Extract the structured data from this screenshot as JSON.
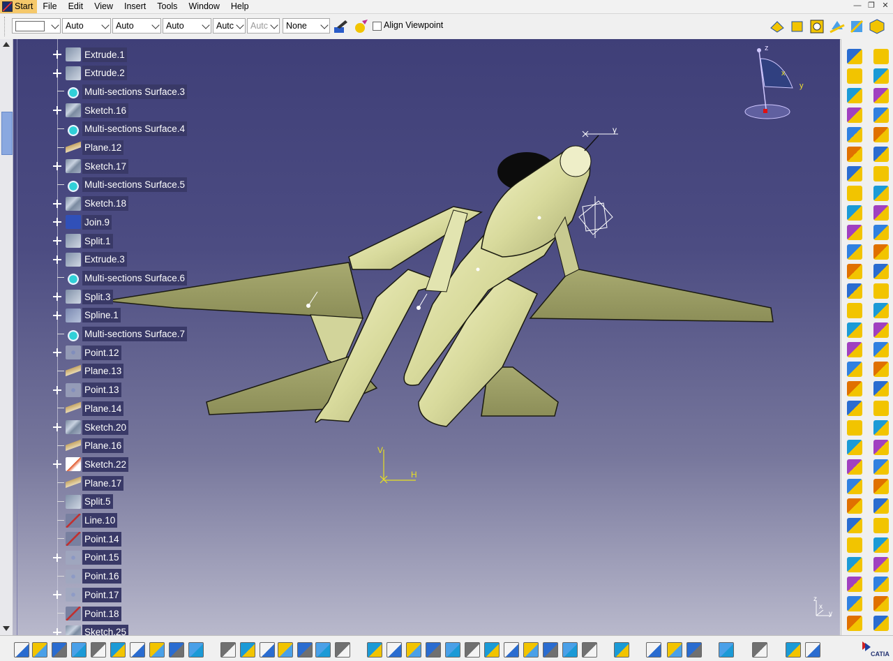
{
  "menubar": {
    "start": "Start",
    "items": [
      "File",
      "Edit",
      "View",
      "Insert",
      "Tools",
      "Window",
      "Help"
    ]
  },
  "toolbar": {
    "combos": [
      "Auto",
      "Auto",
      "Auto",
      "Autc",
      "Autc",
      "None"
    ],
    "align_viewpoint": "Align Viewpoint"
  },
  "tree": {
    "items": [
      {
        "label": "Extrude.1",
        "icon": "extrude",
        "expand": true
      },
      {
        "label": "Extrude.2",
        "icon": "extrude",
        "expand": true
      },
      {
        "label": "Multi-sections Surface.3",
        "icon": "surface",
        "expand": false
      },
      {
        "label": "Sketch.16",
        "icon": "sketch",
        "expand": true
      },
      {
        "label": "Multi-sections Surface.4",
        "icon": "surface",
        "expand": false
      },
      {
        "label": "Plane.12",
        "icon": "plane",
        "expand": false
      },
      {
        "label": "Sketch.17",
        "icon": "sketch",
        "expand": true
      },
      {
        "label": "Multi-sections Surface.5",
        "icon": "surface",
        "expand": false
      },
      {
        "label": "Sketch.18",
        "icon": "sketch",
        "expand": true
      },
      {
        "label": "Join.9",
        "icon": "join",
        "expand": true
      },
      {
        "label": "Split.1",
        "icon": "extrude",
        "expand": true
      },
      {
        "label": "Extrude.3",
        "icon": "extrude",
        "expand": true
      },
      {
        "label": "Multi-sections Surface.6",
        "icon": "surface",
        "expand": false
      },
      {
        "label": "Split.3",
        "icon": "extrude",
        "expand": true
      },
      {
        "label": "Spline.1",
        "icon": "spline",
        "expand": true
      },
      {
        "label": "Multi-sections Surface.7",
        "icon": "surface",
        "expand": false
      },
      {
        "label": "Point.12",
        "icon": "point",
        "expand": true
      },
      {
        "label": "Plane.13",
        "icon": "plane",
        "expand": false
      },
      {
        "label": "Point.13",
        "icon": "point",
        "expand": true
      },
      {
        "label": "Plane.14",
        "icon": "plane",
        "expand": false
      },
      {
        "label": "Sketch.20",
        "icon": "sketch",
        "expand": true
      },
      {
        "label": "Plane.16",
        "icon": "plane",
        "expand": false
      },
      {
        "label": "Sketch.22",
        "icon": "sketch-sel",
        "expand": true
      },
      {
        "label": "Plane.17",
        "icon": "plane",
        "expand": false
      },
      {
        "label": "Split.5",
        "icon": "extrude",
        "expand": false
      },
      {
        "label": "Line.10",
        "icon": "line",
        "expand": false
      },
      {
        "label": "Point.14",
        "icon": "line",
        "expand": false
      },
      {
        "label": "Point.15",
        "icon": "point",
        "expand": true
      },
      {
        "label": "Point.16",
        "icon": "point",
        "expand": false
      },
      {
        "label": "Point.17",
        "icon": "point",
        "expand": true
      },
      {
        "label": "Point.18",
        "icon": "line",
        "expand": false
      },
      {
        "label": "Sketch.25",
        "icon": "sketch",
        "expand": true
      }
    ]
  },
  "compass": {
    "z": "z",
    "x": "x",
    "y": "y"
  },
  "model_axis": {
    "v": "V",
    "h": "H"
  },
  "sketch_axis": {
    "y": "y"
  },
  "mini_axis": {
    "z": "z",
    "x": "x",
    "y": "y"
  },
  "colors": {
    "viewport_top": "#3f3f78",
    "viewport_bottom": "#b9b9cc",
    "aircraft": "#d7d99a",
    "tree_label_bg": "#393967",
    "menu_start": "#f5c86a"
  }
}
